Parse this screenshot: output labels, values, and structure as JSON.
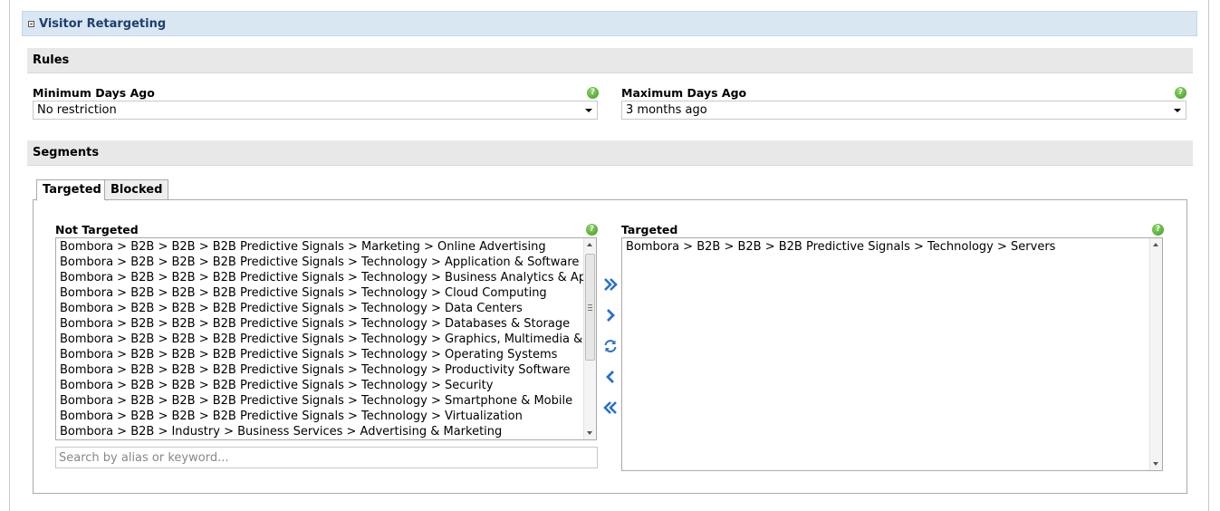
{
  "section": {
    "title": "Visitor Retargeting"
  },
  "rules": {
    "title": "Rules",
    "min_days": {
      "label": "Minimum Days Ago",
      "value": "No restriction"
    },
    "max_days": {
      "label": "Maximum Days Ago",
      "value": "3 months ago"
    }
  },
  "segments": {
    "title": "Segments",
    "tabs": [
      {
        "label": "Targeted"
      },
      {
        "label": "Blocked"
      }
    ],
    "not_targeted": {
      "label": "Not Targeted",
      "items": [
        "Bombora > B2B > B2B > B2B Predictive Signals > Marketing > Online Advertising",
        "Bombora > B2B > B2B > B2B Predictive Signals > Technology > Application & Software",
        "Bombora > B2B > B2B > B2B Predictive Signals > Technology > Business Analytics & Ap",
        "Bombora > B2B > B2B > B2B Predictive Signals > Technology > Cloud Computing",
        "Bombora > B2B > B2B > B2B Predictive Signals > Technology > Data Centers",
        "Bombora > B2B > B2B > B2B Predictive Signals > Technology > Databases & Storage",
        "Bombora > B2B > B2B > B2B Predictive Signals > Technology > Graphics, Multimedia &",
        "Bombora > B2B > B2B > B2B Predictive Signals > Technology > Operating Systems",
        "Bombora > B2B > B2B > B2B Predictive Signals > Technology > Productivity Software",
        "Bombora > B2B > B2B > B2B Predictive Signals > Technology > Security",
        "Bombora > B2B > B2B > B2B Predictive Signals > Technology > Smartphone & Mobile",
        "Bombora > B2B > B2B > B2B Predictive Signals > Technology > Virtualization",
        "Bombora > B2B > Industry > Business Services > Advertising & Marketing"
      ]
    },
    "targeted": {
      "label": "Targeted",
      "items": [
        "Bombora > B2B > B2B > B2B Predictive Signals > Technology > Servers"
      ]
    },
    "search": {
      "placeholder": "Search by alias or keyword..."
    }
  },
  "icons": {
    "help": "help-icon",
    "move_all_right": "double-chevron-right-icon",
    "move_right": "chevron-right-icon",
    "refresh": "refresh-icon",
    "move_left": "chevron-left-icon",
    "move_all_left": "double-chevron-left-icon"
  },
  "colors": {
    "header_bg": "#d9e7f3",
    "header_text": "#1f3f6e",
    "subbar_bg": "#e8e8e8",
    "help_green": "#3d9a1f",
    "arrow_blue": "#2a6fc9"
  }
}
